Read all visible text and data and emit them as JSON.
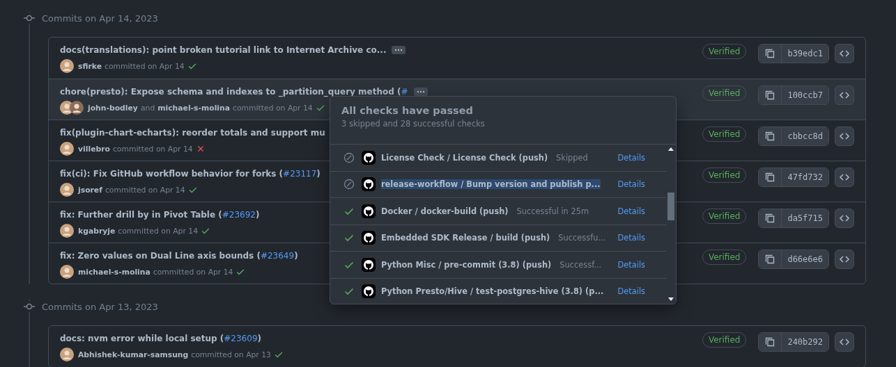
{
  "groups": [
    {
      "heading": "Commits on Apr 14, 2023",
      "commits": [
        {
          "title": "docs(translations): point broken tutorial link to Internet Archive co...",
          "more": true,
          "highlighted": false,
          "authors": [
            "sfirke"
          ],
          "meta": "committed on Apr 14",
          "passed": true,
          "badge": "Verified",
          "sha": "b39edc1"
        },
        {
          "title": "chore(presto): Expose schema and indexes to _partition_query method (",
          "pr": "#",
          "more": true,
          "highlighted": true,
          "authors": [
            "john-bodley",
            "michael-s-molina"
          ],
          "joiner": "and",
          "meta": "committed on Apr 14",
          "passed": true,
          "badge": "Verified",
          "sha": "100ccb7"
        },
        {
          "title": "fix(plugin-chart-echarts): reorder totals and support mu",
          "more": false,
          "highlighted": false,
          "authors": [
            "villebro"
          ],
          "meta": "committed on Apr 14",
          "passed": false,
          "badge": "Verified",
          "sha": "cbbcc8d"
        },
        {
          "title": "fix(ci): Fix GitHub workflow behavior for forks (",
          "pr": "#23117",
          "title_end": ")",
          "more": false,
          "highlighted": false,
          "authors": [
            "jsoref"
          ],
          "meta": "committed on Apr 14",
          "passed": true,
          "badge": "Verified",
          "sha": "47fd732"
        },
        {
          "title": "fix: Further drill by in Pivot Table (",
          "pr": "#23692",
          "title_end": ")",
          "more": false,
          "highlighted": false,
          "authors": [
            "kgabryje"
          ],
          "meta": "committed on Apr 14",
          "passed": true,
          "badge": "Verified",
          "sha": "da5f715"
        },
        {
          "title": "fix: Zero values on Dual Line axis bounds (",
          "pr": "#23649",
          "title_end": ")",
          "more": false,
          "highlighted": false,
          "authors": [
            "michael-s-molina"
          ],
          "meta": "committed on Apr 14",
          "passed": true,
          "badge": "Verified",
          "sha": "d66e6e6"
        }
      ]
    },
    {
      "heading": "Commits on Apr 13, 2023",
      "commits": [
        {
          "title": "docs: nvm error while local setup (",
          "pr": "#23609",
          "title_end": ")",
          "more": false,
          "highlighted": false,
          "authors": [
            "Abhishek-kumar-samsung"
          ],
          "meta": "committed on Apr 13",
          "passed": true,
          "badge": "Verified",
          "sha": "240b292"
        }
      ]
    }
  ],
  "checks_popover": {
    "title": "All checks have passed",
    "summary": "3 skipped and 28 successful checks",
    "checks": [
      {
        "skipped": true,
        "name": "License Check / License Check (push)",
        "detail": "Skipped",
        "link": "Details",
        "selected": false
      },
      {
        "skipped": true,
        "name": "release-workflow / Bump version and publish p...",
        "link": "Details",
        "selected": true
      },
      {
        "skipped": false,
        "name": "Docker / docker-build (push)",
        "detail": "Successful in 25m",
        "link": "Details",
        "selected": false
      },
      {
        "skipped": false,
        "name": "Embedded SDK Release / build (push)",
        "detail": "Successfu...",
        "link": "Details",
        "selected": false
      },
      {
        "skipped": false,
        "name": "Python Misc / pre-commit (3.8) (push)",
        "detail": "Successf...",
        "link": "Details",
        "selected": false
      },
      {
        "skipped": false,
        "name": "Python Presto/Hive / test-postgres-hive (3.8) (p...",
        "link": "Details",
        "selected": false
      }
    ]
  }
}
